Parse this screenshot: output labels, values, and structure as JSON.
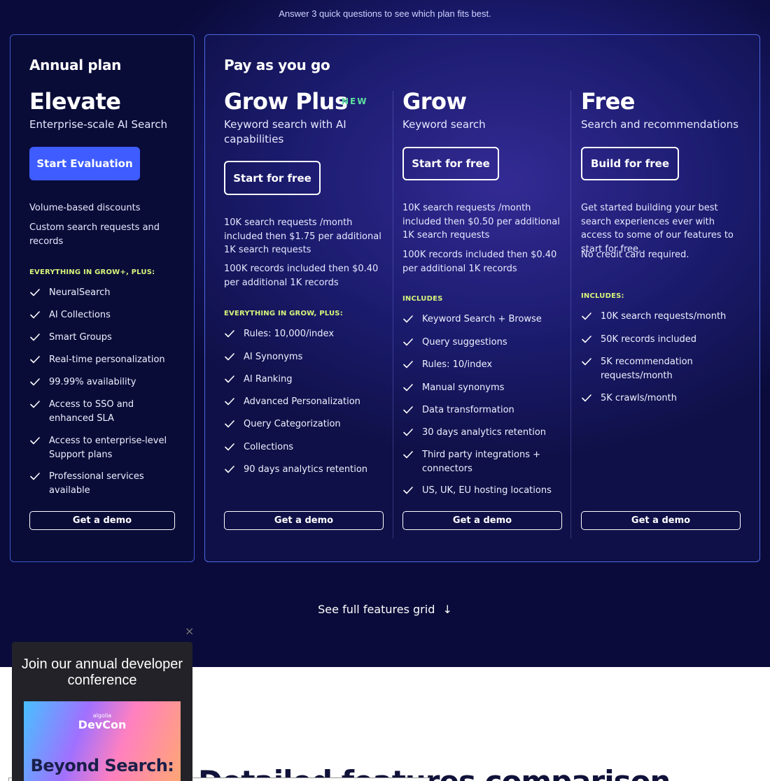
{
  "header": {
    "tagline": "Answer 3 quick questions to see which plan fits best."
  },
  "groups": {
    "annual": "Annual plan",
    "payg": "Pay as you go"
  },
  "plans": {
    "elevate": {
      "name": "Elevate",
      "subtitle": "Enterprise-scale AI Search",
      "cta": "Start Evaluation",
      "desc": [
        "Volume-based discounts",
        "Custom search requests and records"
      ],
      "section": "EVERYTHING IN GROW+, PLUS:",
      "features": [
        "NeuralSearch",
        "AI Collections",
        "Smart Groups",
        "Real-time personalization",
        "99.99% availability",
        "Access to SSO and enhanced SLA",
        "Access to enterprise-level Support plans",
        "Professional services available"
      ],
      "demo": "Get a demo"
    },
    "growplus": {
      "name": "Grow Plus",
      "badge": "NEW",
      "subtitle": "Keyword search with AI capabilities",
      "cta": "Start for free",
      "desc": [
        "10K search requests /month included then $1.75 per additional 1K search requests",
        "100K records included then $0.40 per additional 1K records"
      ],
      "section": "EVERYTHING IN GROW, PLUS:",
      "features": [
        "Rules: 10,000/index",
        "AI Synonyms",
        "AI Ranking",
        "Advanced Personalization",
        "Query Categorization",
        "Collections",
        "90 days analytics retention"
      ],
      "demo": "Get a demo"
    },
    "grow": {
      "name": "Grow",
      "subtitle": "Keyword search",
      "cta": "Start for free",
      "desc": [
        "10K search requests /month included then $0.50 per additional 1K search requests",
        "100K records included then $0.40 per additional 1K records"
      ],
      "section": "INCLUDES",
      "features": [
        "Keyword Search + Browse",
        "Query suggestions",
        "Rules: 10/index",
        "Manual synonyms",
        "Data transformation",
        "30 days analytics retention",
        "Third party integrations + connectors",
        "US, UK, EU hosting locations"
      ],
      "demo": "Get a demo"
    },
    "free": {
      "name": "Free",
      "subtitle": "Search and recommendations",
      "cta": "Build for free",
      "desc": [
        "Get started building your best search experiences ever with access to some of our features to start for free.",
        "No credit card required."
      ],
      "section": "INCLUDES:",
      "features": [
        "10K search requests/month",
        "50K records included",
        "5K recommendation requests/month",
        "5K crawls/month"
      ],
      "demo": "Get a demo"
    }
  },
  "see_grid": {
    "label": "See full features grid",
    "arrow": "↓"
  },
  "popup": {
    "title": "Join our annual developer conference",
    "logo": "algolia",
    "event": "DevCon",
    "headline": "Beyond Search:",
    "close": "×"
  },
  "section_heading": "Detailed features comparison",
  "icons": {
    "check": "check-icon",
    "arrow": "arrow-down-icon",
    "close": "close-icon"
  }
}
